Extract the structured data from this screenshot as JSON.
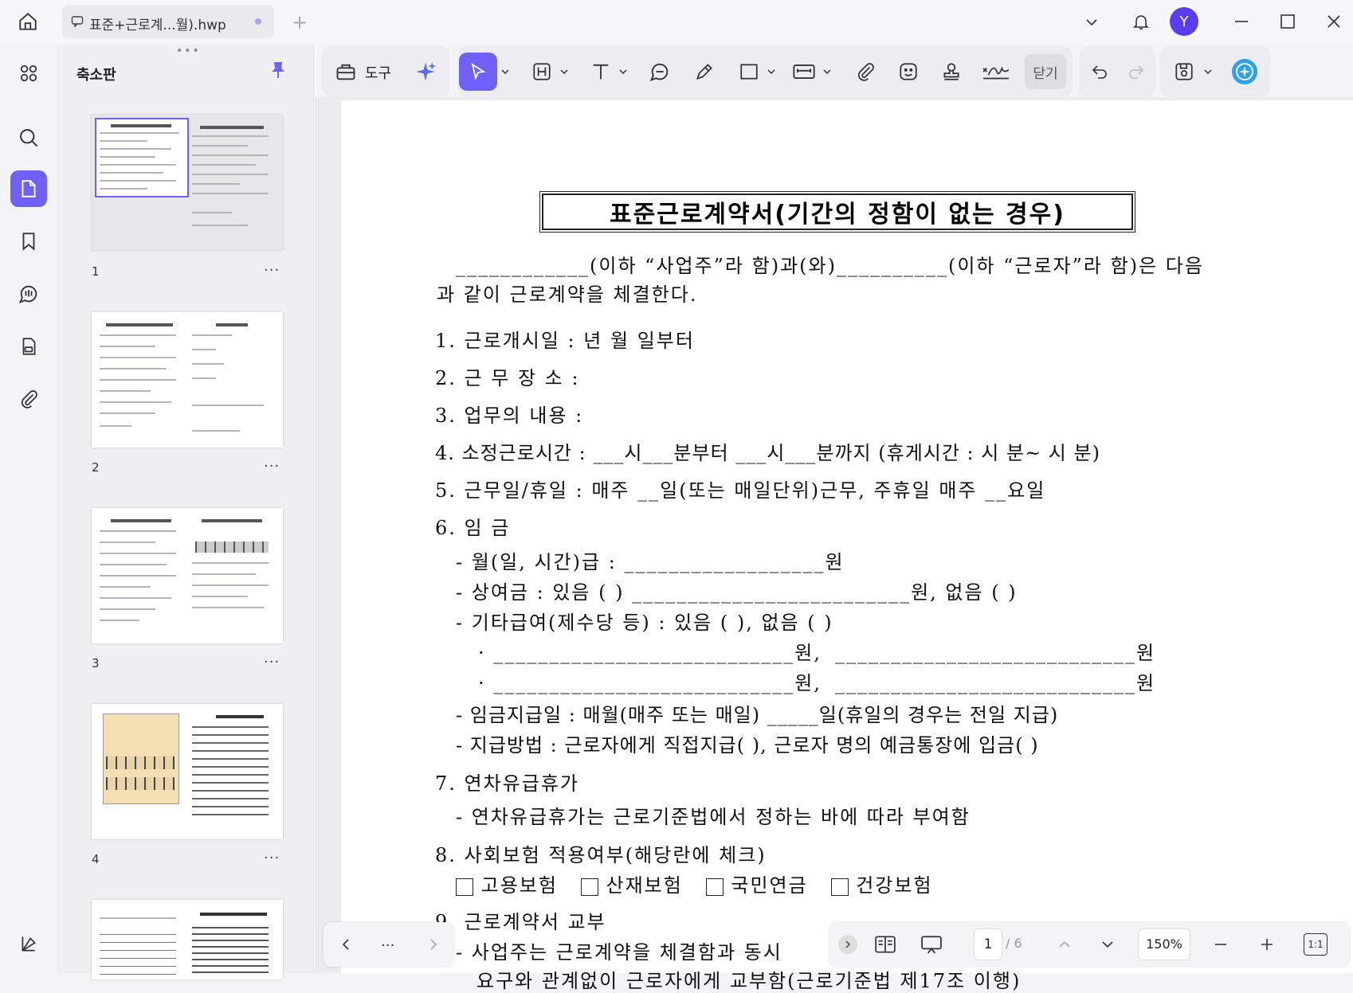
{
  "tab": {
    "title": "표준+근로계...월).hwp"
  },
  "user": {
    "avatar_letter": "Y"
  },
  "thumbnails": {
    "panel_title": "축소판",
    "pages": [
      {
        "number": "1",
        "more": "..."
      },
      {
        "number": "2",
        "more": "..."
      },
      {
        "number": "3",
        "more": "..."
      },
      {
        "number": "4",
        "more": "..."
      }
    ]
  },
  "toolbar": {
    "tools_label": "도구",
    "close_label": "닫기"
  },
  "document": {
    "title": "표준근로계약서(기간의 정함이 없는 경우)",
    "intro_line1": "____________(이하 “사업주”라 함)과(와)__________(이하 “근로자”라 함)은 다음",
    "intro_line2": "과 같이 근로계약을 체결한다.",
    "item1": "1. 근로개시일 :        년     월     일부터",
    "item2": "2. 근 무 장 소 :",
    "item3": "3. 업무의 내용 :",
    "item4": "4. 소정근로시간 : ___시___분부터 ___시___분까지 (휴게시간 :  시  분~  시   분)",
    "item5": "5. 근무일/휴일 : 매주 __일(또는 매일단위)근무, 주휴일 매주 __요일",
    "item6": "6. 임   금",
    "item6_a": "- 월(일, 시간)급 : __________________원",
    "item6_b": "- 상여금 : 있음 (     ) _________________________원,  없음 (      )",
    "item6_c": "- 기타급여(제수당 등) : 있음 (     ),   없음 (     )",
    "item6_c1_left": "· ___________________________원,",
    "item6_c1_right": "___________________________원",
    "item6_c2_left": "· ___________________________원,",
    "item6_c2_right": "___________________________원",
    "item6_d": "- 임금지급일 : 매월(매주 또는 매일)  _____일(휴일의 경우는 전일 지급)",
    "item6_e": "- 지급방법 : 근로자에게 직접지급(     ),  근로자 명의 예금통장에 입금(     )",
    "item7": "7. 연차유급휴가",
    "item7_a": "- 연차유급휴가는 근로기준법에서 정하는 바에 따라 부여함",
    "item8": "8. 사회보험 적용여부(해당란에 체크)",
    "item8_opts": [
      "고용보험",
      "산재보험",
      "국민연금",
      "건강보험"
    ],
    "item9": "9. 근로계약서 교부",
    "item9_a": "- 사업주는 근로계약을 체결함과 동시",
    "item9_b": "요구와 관계없이 근로자에게 교부함(근로기준법 제17조 이행)"
  },
  "pagenav": {
    "current": "1",
    "total": "/ 6",
    "zoom": "150%",
    "fit": "1:1",
    "dots": "..."
  }
}
